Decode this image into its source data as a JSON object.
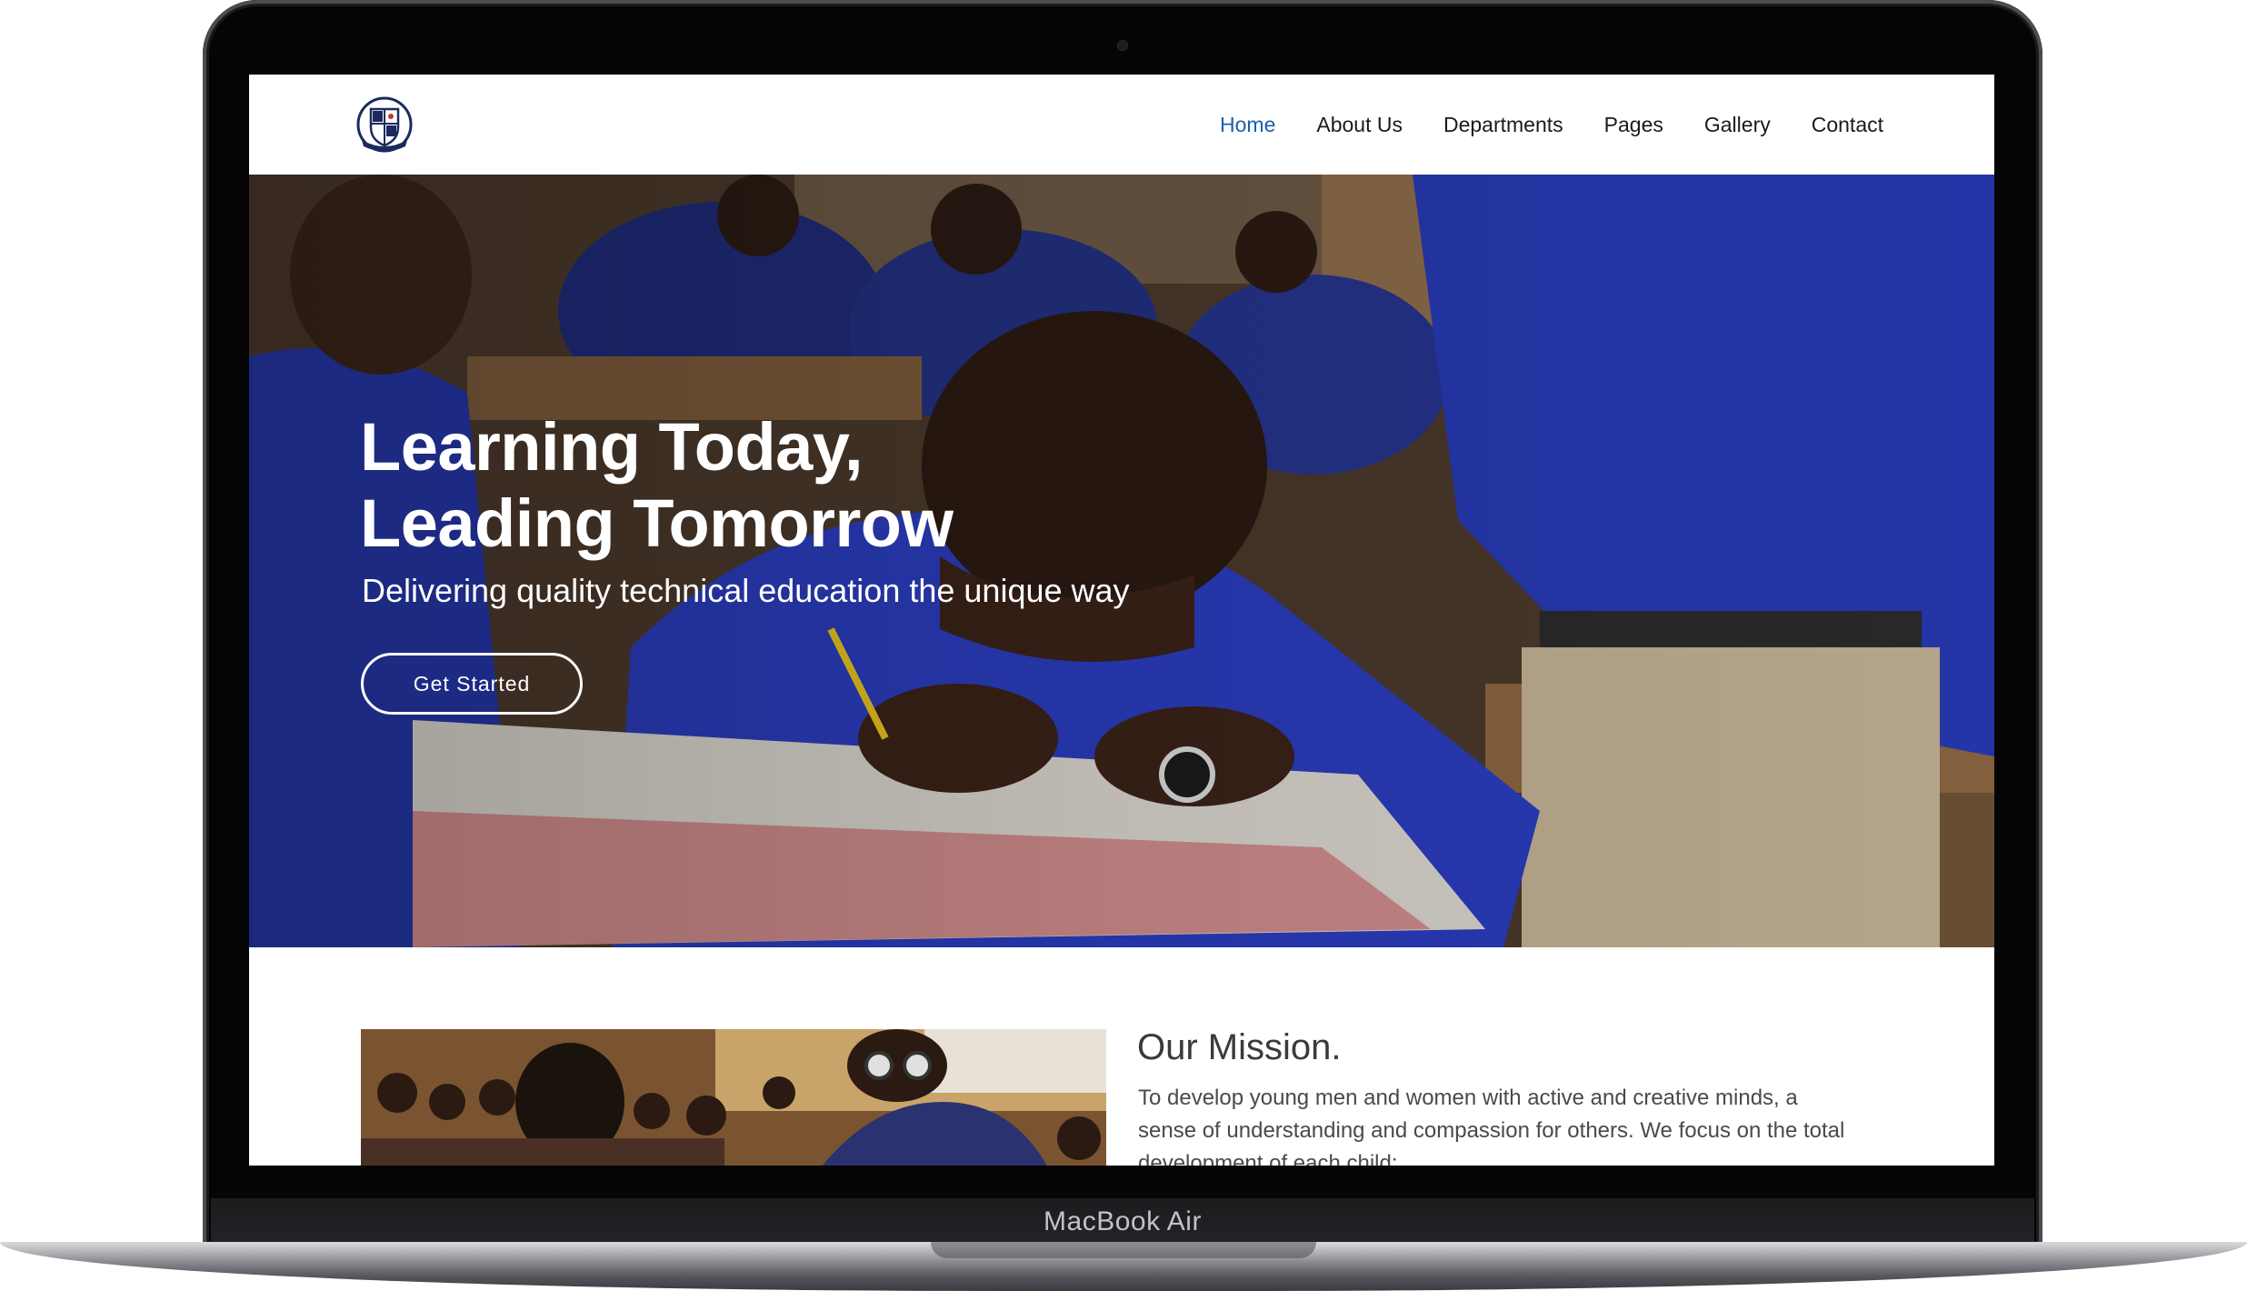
{
  "device": {
    "model_label": "MacBook Air"
  },
  "site": {
    "logo_icon": "school-crest-icon",
    "nav": [
      {
        "label": "Home",
        "active": true
      },
      {
        "label": "About Us",
        "active": false
      },
      {
        "label": "Departments",
        "active": false
      },
      {
        "label": "Pages",
        "active": false
      },
      {
        "label": "Gallery",
        "active": false
      },
      {
        "label": "Contact",
        "active": false
      }
    ],
    "colors": {
      "nav_active": "#1c5db0",
      "uniform_blue": "#2233a8"
    }
  },
  "hero": {
    "title_line1": "Learning Today,",
    "title_line2": "Leading Tomorrow",
    "subtitle": "Delivering quality technical education the unique way",
    "cta_label": "Get Started"
  },
  "mission": {
    "title": "Our Mission.",
    "text": "To develop young men and women with active and creative minds, a sense of understanding and compassion for others. We focus on the total development of each child:"
  }
}
